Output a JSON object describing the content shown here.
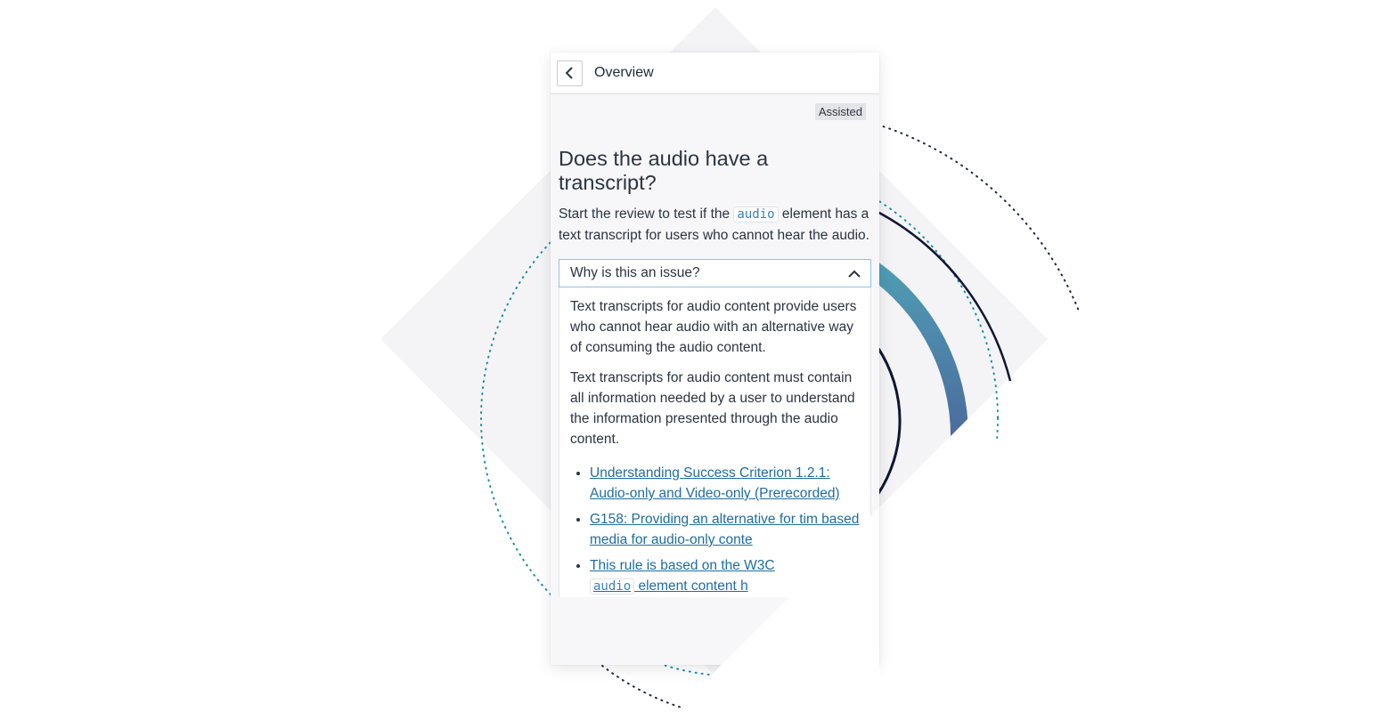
{
  "header": {
    "back_icon": "chevron-left-icon",
    "title": "Overview"
  },
  "badge": "Assisted",
  "question": {
    "title": "Does the audio have a transcript?",
    "desc_pre": "Start the review to test if the ",
    "desc_code": "audio",
    "desc_post": " element has a text transcript for users who cannot hear the audio."
  },
  "accordion": {
    "title": "Why is this an issue?",
    "toggle_icon": "chevron-up-icon",
    "paragraphs": [
      "Text transcripts for audio content provide users who cannot hear audio with an alternative way of consuming the audio content.",
      "Text transcripts for audio content must contain all information needed by a user to understand the information presented through the audio content."
    ],
    "links": [
      "Understanding Success Criterion 1.2.1: Audio-only and Video-only (Prerecorded)",
      "G158: Providing an alternative for tim based media for audio-only conte",
      {
        "pre": "This rule is based on the W3C",
        "code": "audio",
        "post": " element content h"
      }
    ]
  },
  "colors": {
    "accent_blue": "#1f6d9e",
    "accordion_border": "#8fc3e3",
    "dotted_teal": "#1a8fa8",
    "arc_gradient_start": "#4f9fb5",
    "arc_gradient_end": "#4b6a9c",
    "arc_dark": "#0f1535"
  }
}
